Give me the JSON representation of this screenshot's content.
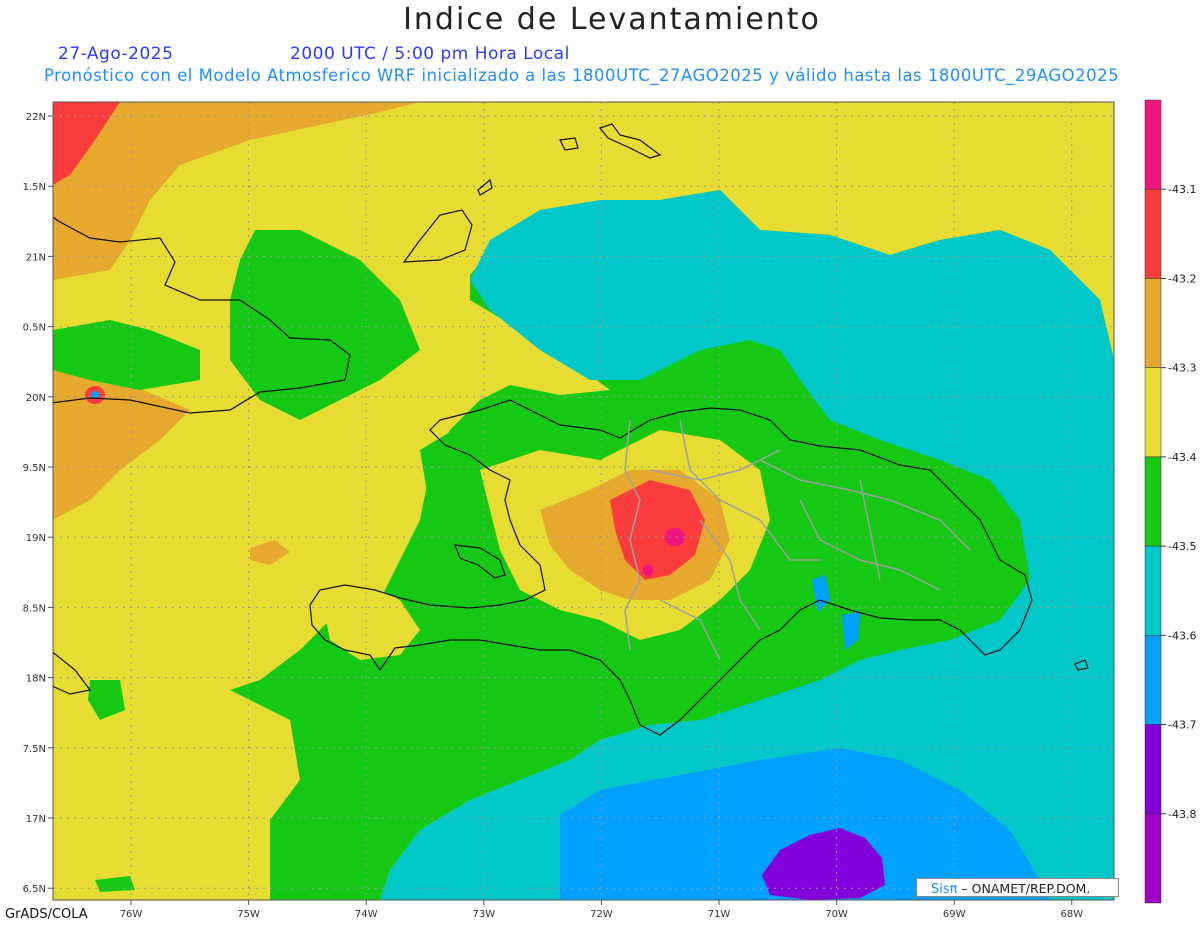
{
  "header": {
    "title": "Indice de Levantamiento",
    "date": "27-Ago-2025",
    "time": "2000 UTC / 5:00 pm Hora Local",
    "model_line": "Pronóstico con el Modelo Atmosferico WRF inicializado a las 1800UTC_27AGO2025 y válido hasta las  1800UTC_29AGO2025"
  },
  "map": {
    "lon_labels": [
      "76W",
      "75W",
      "74W",
      "73W",
      "72W",
      "71W",
      "70W",
      "69W",
      "68W"
    ],
    "lat_labels": [
      "22N",
      "1.5N",
      "21N",
      "0.5N",
      "20N",
      "9.5N",
      "19N",
      "8.5N",
      "18N",
      "7.5N",
      "17N",
      "6.5N"
    ]
  },
  "colorbar": {
    "labels": [
      "-43.1",
      "-43.2",
      "-43.3",
      "-43.4",
      "-43.5",
      "-43.6",
      "-43.7",
      "-43.8"
    ],
    "colors": [
      "#f0147f",
      "#fa3c3c",
      "#e6a82d",
      "#e6dc32",
      "#14c814",
      "#00c8c8",
      "#00a0ff",
      "#8200dc",
      "#a000c8"
    ]
  },
  "palette": {
    "magenta": "#f0147f",
    "red": "#fa3c3c",
    "orange": "#e6a82d",
    "yellow": "#e6dc32",
    "green": "#14c814",
    "cyan": "#00c8c8",
    "blue": "#00a0ff",
    "purple": "#8200dc"
  },
  "credit": {
    "brand": "Sisπ",
    "text": "– ONAMET/REP.DOM."
  },
  "footer": {
    "software": "GrADS/COLA"
  }
}
